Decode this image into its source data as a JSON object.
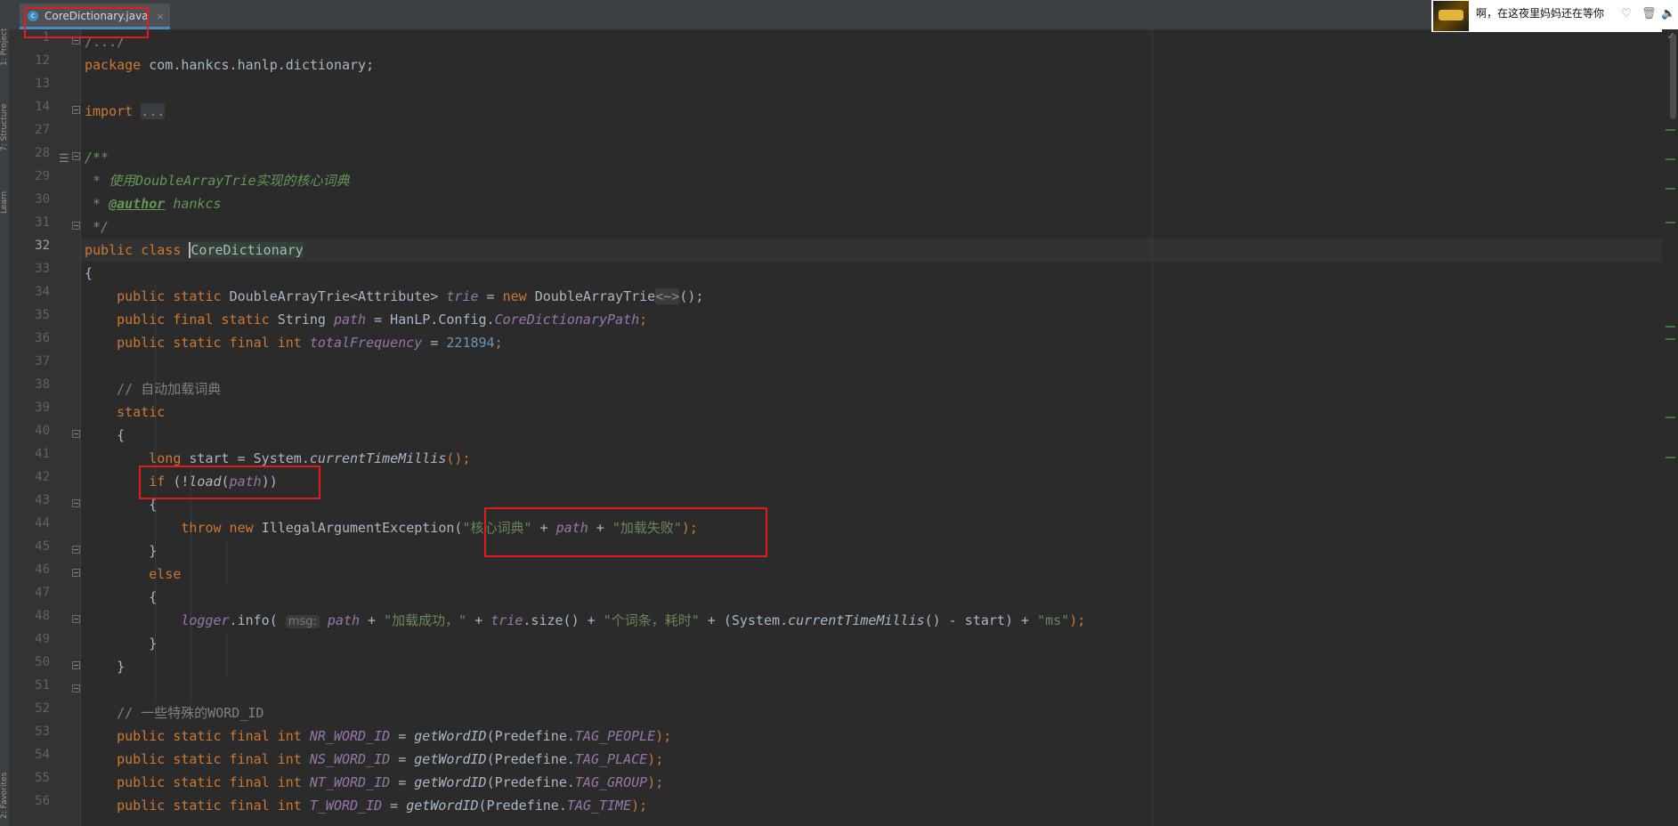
{
  "tab": {
    "file_name": "CoreDictionary.java",
    "close_glyph": "×",
    "icon_letter": "c"
  },
  "tool_window_labels": [
    "1: Project",
    "7: Structure",
    "Learn",
    "2: Favorites"
  ],
  "notification": {
    "text": "啊，在这夜里妈妈还在等你"
  },
  "current_line": "32",
  "lines": [
    {
      "n": "1"
    },
    {
      "n": "12"
    },
    {
      "n": "13"
    },
    {
      "n": "14"
    },
    {
      "n": "27"
    },
    {
      "n": "28"
    },
    {
      "n": "29"
    },
    {
      "n": "30"
    },
    {
      "n": "31"
    },
    {
      "n": "32"
    },
    {
      "n": "33"
    },
    {
      "n": "34"
    },
    {
      "n": "35"
    },
    {
      "n": "36"
    },
    {
      "n": "37"
    },
    {
      "n": "38"
    },
    {
      "n": "39"
    },
    {
      "n": "40"
    },
    {
      "n": "41"
    },
    {
      "n": "42"
    },
    {
      "n": "43"
    },
    {
      "n": "44"
    },
    {
      "n": "45"
    },
    {
      "n": "46"
    },
    {
      "n": "47"
    },
    {
      "n": "48"
    },
    {
      "n": "49"
    },
    {
      "n": "50"
    },
    {
      "n": "51"
    },
    {
      "n": "52"
    },
    {
      "n": "53"
    },
    {
      "n": "54"
    },
    {
      "n": "55"
    },
    {
      "n": "56"
    }
  ],
  "code": {
    "l1": "/.../",
    "l12_kw": "package",
    "l12_rest": " com.hankcs.hanlp.dictionary;",
    "l14_kw": "import",
    "l14_fold": "...",
    "l28": "/**",
    "l29_star": " * ",
    "l29_text": "使用DoubleArrayTrie实现的核心词典",
    "l30_star": " * ",
    "l30_tag": "@author",
    "l30_text": " hankcs",
    "l31": " */",
    "l32_kw": "public class ",
    "l32_cls": "CoreDictionary",
    "l33": "{",
    "l34_kw1": "public static ",
    "l34_t": "DoubleArrayTrie<Attribute> ",
    "l34_f": "trie",
    "l34_eq": " = ",
    "l34_kw2": "new ",
    "l34_c": "DoubleArrayTrie",
    "l34_diamond": "<~>",
    "l34_end": "();",
    "l35_kw": "public final static ",
    "l35_t": "String ",
    "l35_f": "path",
    "l35_eq": " = HanLP.Config.",
    "l35_c": "CoreDictionaryPath",
    "l35_end": ";",
    "l36_kw": "public static final int ",
    "l36_f": "totalFrequency",
    "l36_eq": " = ",
    "l36_num": "221894",
    "l36_end": ";",
    "l38": "// 自动加载词典",
    "l39": "static",
    "l40": "{",
    "l41_kw": "long ",
    "l41_rest": "start = System.",
    "l41_m": "currentTimeMillis",
    "l41_end": "();",
    "l42_kw": "if ",
    "l42_a": "(!",
    "l42_m": "load",
    "l42_b": "(",
    "l42_f": "path",
    "l42_c": "))",
    "l43": "{",
    "l44_kw": "throw new ",
    "l44_c": "IllegalArgumentException(",
    "l44_s1": "\"核心词典\"",
    "l44_plus1": " + ",
    "l44_f": "path",
    "l44_plus2": " + ",
    "l44_s2": "\"加载失败\"",
    "l44_end": ");",
    "l45": "}",
    "l46": "else",
    "l47": "{",
    "l48_f": "logger",
    "l48_a": ".info( ",
    "l48_hint": "msg:",
    "l48_sp": " ",
    "l48_f2": "path",
    "l48_p1": " + ",
    "l48_s1": "\"加载成功，\"",
    "l48_p2": " + ",
    "l48_f3": "trie",
    "l48_b": ".size() + ",
    "l48_s2": "\"个词条，耗时\"",
    "l48_c": " + (System.",
    "l48_m": "currentTimeMillis",
    "l48_d": "() - start) + ",
    "l48_s3": "\"ms\"",
    "l48_end": ");",
    "l49": "}",
    "l50": "}",
    "l52": "// 一些特殊的WORD_ID",
    "l53_kw": "public static final int ",
    "l53_f": "NR_WORD_ID",
    "l53_eq": " = ",
    "l53_m": "getWordID",
    "l53_a": "(Predefine.",
    "l53_c": "TAG_PEOPLE",
    "l53_end": ");",
    "l54_kw": "public static final int ",
    "l54_f": "NS_WORD_ID",
    "l54_eq": " = ",
    "l54_m": "getWordID",
    "l54_a": "(Predefine.",
    "l54_c": "TAG_PLACE",
    "l54_end": ");",
    "l55_kw": "public static final int ",
    "l55_f": "NT_WORD_ID",
    "l55_eq": " = ",
    "l55_m": "getWordID",
    "l55_a": "(Predefine.",
    "l55_c": "TAG_GROUP",
    "l55_end": ");",
    "l56_kw": "public static final int ",
    "l56_f": "T_WORD_ID",
    "l56_eq": " = ",
    "l56_m": "getWordID",
    "l56_a": "(Predefine.",
    "l56_c": "TAG_TIME",
    "l56_end": ");"
  }
}
